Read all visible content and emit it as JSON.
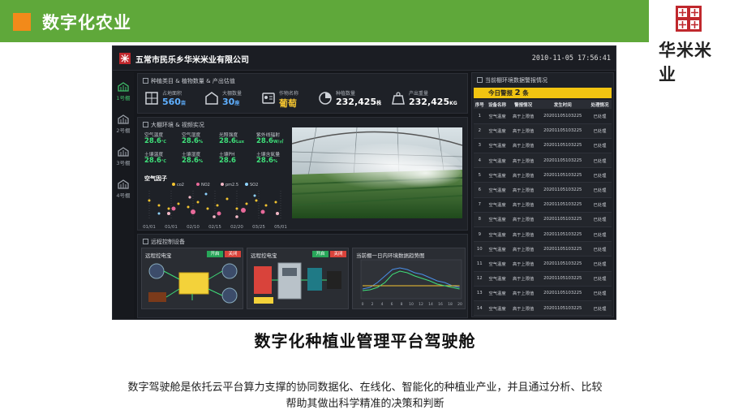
{
  "header": {
    "title": "数字化农业"
  },
  "logo": {
    "text": "华米米业"
  },
  "dashboard": {
    "company": "五常市民乐乡华米米业有限公司",
    "datetime": "2010-11-05 17:56:41",
    "sidebar": [
      {
        "label": "1号棚",
        "active": true
      },
      {
        "label": "2号棚",
        "active": false
      },
      {
        "label": "3号棚",
        "active": false
      },
      {
        "label": "4号棚",
        "active": false
      }
    ],
    "stats_panel": {
      "title": "种植类目 & 植物数量 & 产出估值",
      "items": [
        {
          "label": "占地面积",
          "value": "560",
          "unit": "亩",
          "icon": "area-icon",
          "style": "blue"
        },
        {
          "label": "大棚数量",
          "value": "30",
          "unit": "座",
          "icon": "greenhouse-icon",
          "style": "blue"
        },
        {
          "label": "作物名称",
          "value": "葡萄",
          "unit": "",
          "icon": "crop-card-icon",
          "style": "yellow"
        },
        {
          "label": "种植数量",
          "value": "232,425",
          "unit": "株",
          "icon": "pie-icon",
          "style": "white"
        },
        {
          "label": "产出重量",
          "value": "232,425",
          "unit": "KG",
          "icon": "weight-icon",
          "style": "white"
        }
      ]
    },
    "env_panel": {
      "title": "大棚环境 & 视频实况",
      "readings": [
        {
          "label": "空气温度",
          "value": "28.6",
          "unit": "℃"
        },
        {
          "label": "空气湿度",
          "value": "28.6",
          "unit": "%"
        },
        {
          "label": "光照强度",
          "value": "28.6",
          "unit": "Lux"
        },
        {
          "label": "紫外线辐射",
          "value": "28.6",
          "unit": "W/㎡"
        },
        {
          "label": "土壤温度",
          "value": "28.6",
          "unit": "℃"
        },
        {
          "label": "土壤湿度",
          "value": "28.6",
          "unit": "%"
        },
        {
          "label": "土壤PH",
          "value": "28.6",
          "unit": ""
        },
        {
          "label": "土壤含氮量",
          "value": "28.6",
          "unit": "%"
        }
      ],
      "air_factor_title": "空气因子",
      "legend": [
        "co2",
        "NO2",
        "pm2.5",
        "SO2"
      ],
      "xticks": [
        "01/01",
        "01/01",
        "02/10",
        "02/15",
        "02/20",
        "03/25",
        "05/01"
      ]
    },
    "control_panel": {
      "title": "远程控制设备",
      "units": [
        {
          "title": "远程控电宝",
          "on": "开启",
          "off": "关闭"
        },
        {
          "title": "远程控电宝",
          "on": "开启",
          "off": "关闭"
        }
      ],
      "chart_title": "当前棚一日内环境数据趋势图",
      "chart_xticks": [
        "0",
        "2",
        "4",
        "6",
        "8",
        "10",
        "12",
        "14",
        "16",
        "18",
        "20"
      ]
    },
    "alarm_panel": {
      "title": "当前棚环境数据警报情况",
      "today_prefix": "今日警报",
      "today_count": "2",
      "today_suffix": "条",
      "columns": [
        "序号",
        "设备名称",
        "警报情况",
        "发生时间",
        "处理情况"
      ],
      "rows": [
        [
          "1",
          "空气温度",
          "高于上限值",
          "20201105103225",
          "已处理"
        ],
        [
          "2",
          "空气温度",
          "高于上限值",
          "20201105103225",
          "已处理"
        ],
        [
          "3",
          "空气温度",
          "高于上限值",
          "20201105103225",
          "已处理"
        ],
        [
          "4",
          "空气温度",
          "高于上限值",
          "20201105103225",
          "已处理"
        ],
        [
          "5",
          "空气温度",
          "高于上限值",
          "20201105103225",
          "已处理"
        ],
        [
          "6",
          "空气温度",
          "高于上限值",
          "20201105103225",
          "已处理"
        ],
        [
          "7",
          "空气温度",
          "高于上限值",
          "20201105103225",
          "已处理"
        ],
        [
          "8",
          "空气温度",
          "高于上限值",
          "20201105103225",
          "已处理"
        ],
        [
          "9",
          "空气温度",
          "高于上限值",
          "20201105103225",
          "已处理"
        ],
        [
          "10",
          "空气温度",
          "高于上限值",
          "20201105103225",
          "已处理"
        ],
        [
          "11",
          "空气温度",
          "高于上限值",
          "20201105103225",
          "已处理"
        ],
        [
          "12",
          "空气温度",
          "高于上限值",
          "20201105103225",
          "已处理"
        ],
        [
          "13",
          "空气温度",
          "高于上限值",
          "20201105103225",
          "已处理"
        ],
        [
          "14",
          "空气温度",
          "高于上限值",
          "20201105103225",
          "已处理"
        ]
      ]
    }
  },
  "caption": "数字化种植业管理平台驾驶舱",
  "description_line1": "数字驾驶舱是依托云平台算力支撑的协同数据化、在线化、智能化的种植业产业，并且通过分析、比较",
  "description_line2": "帮助其做出科学精准的决策和判断",
  "colors": {
    "band": "#5fa83a",
    "accent_square": "#f28a1a",
    "alarm_bar": "#f2c511",
    "on_button": "#27a659",
    "off_button": "#d9433b",
    "logo_red": "#c0282d"
  }
}
